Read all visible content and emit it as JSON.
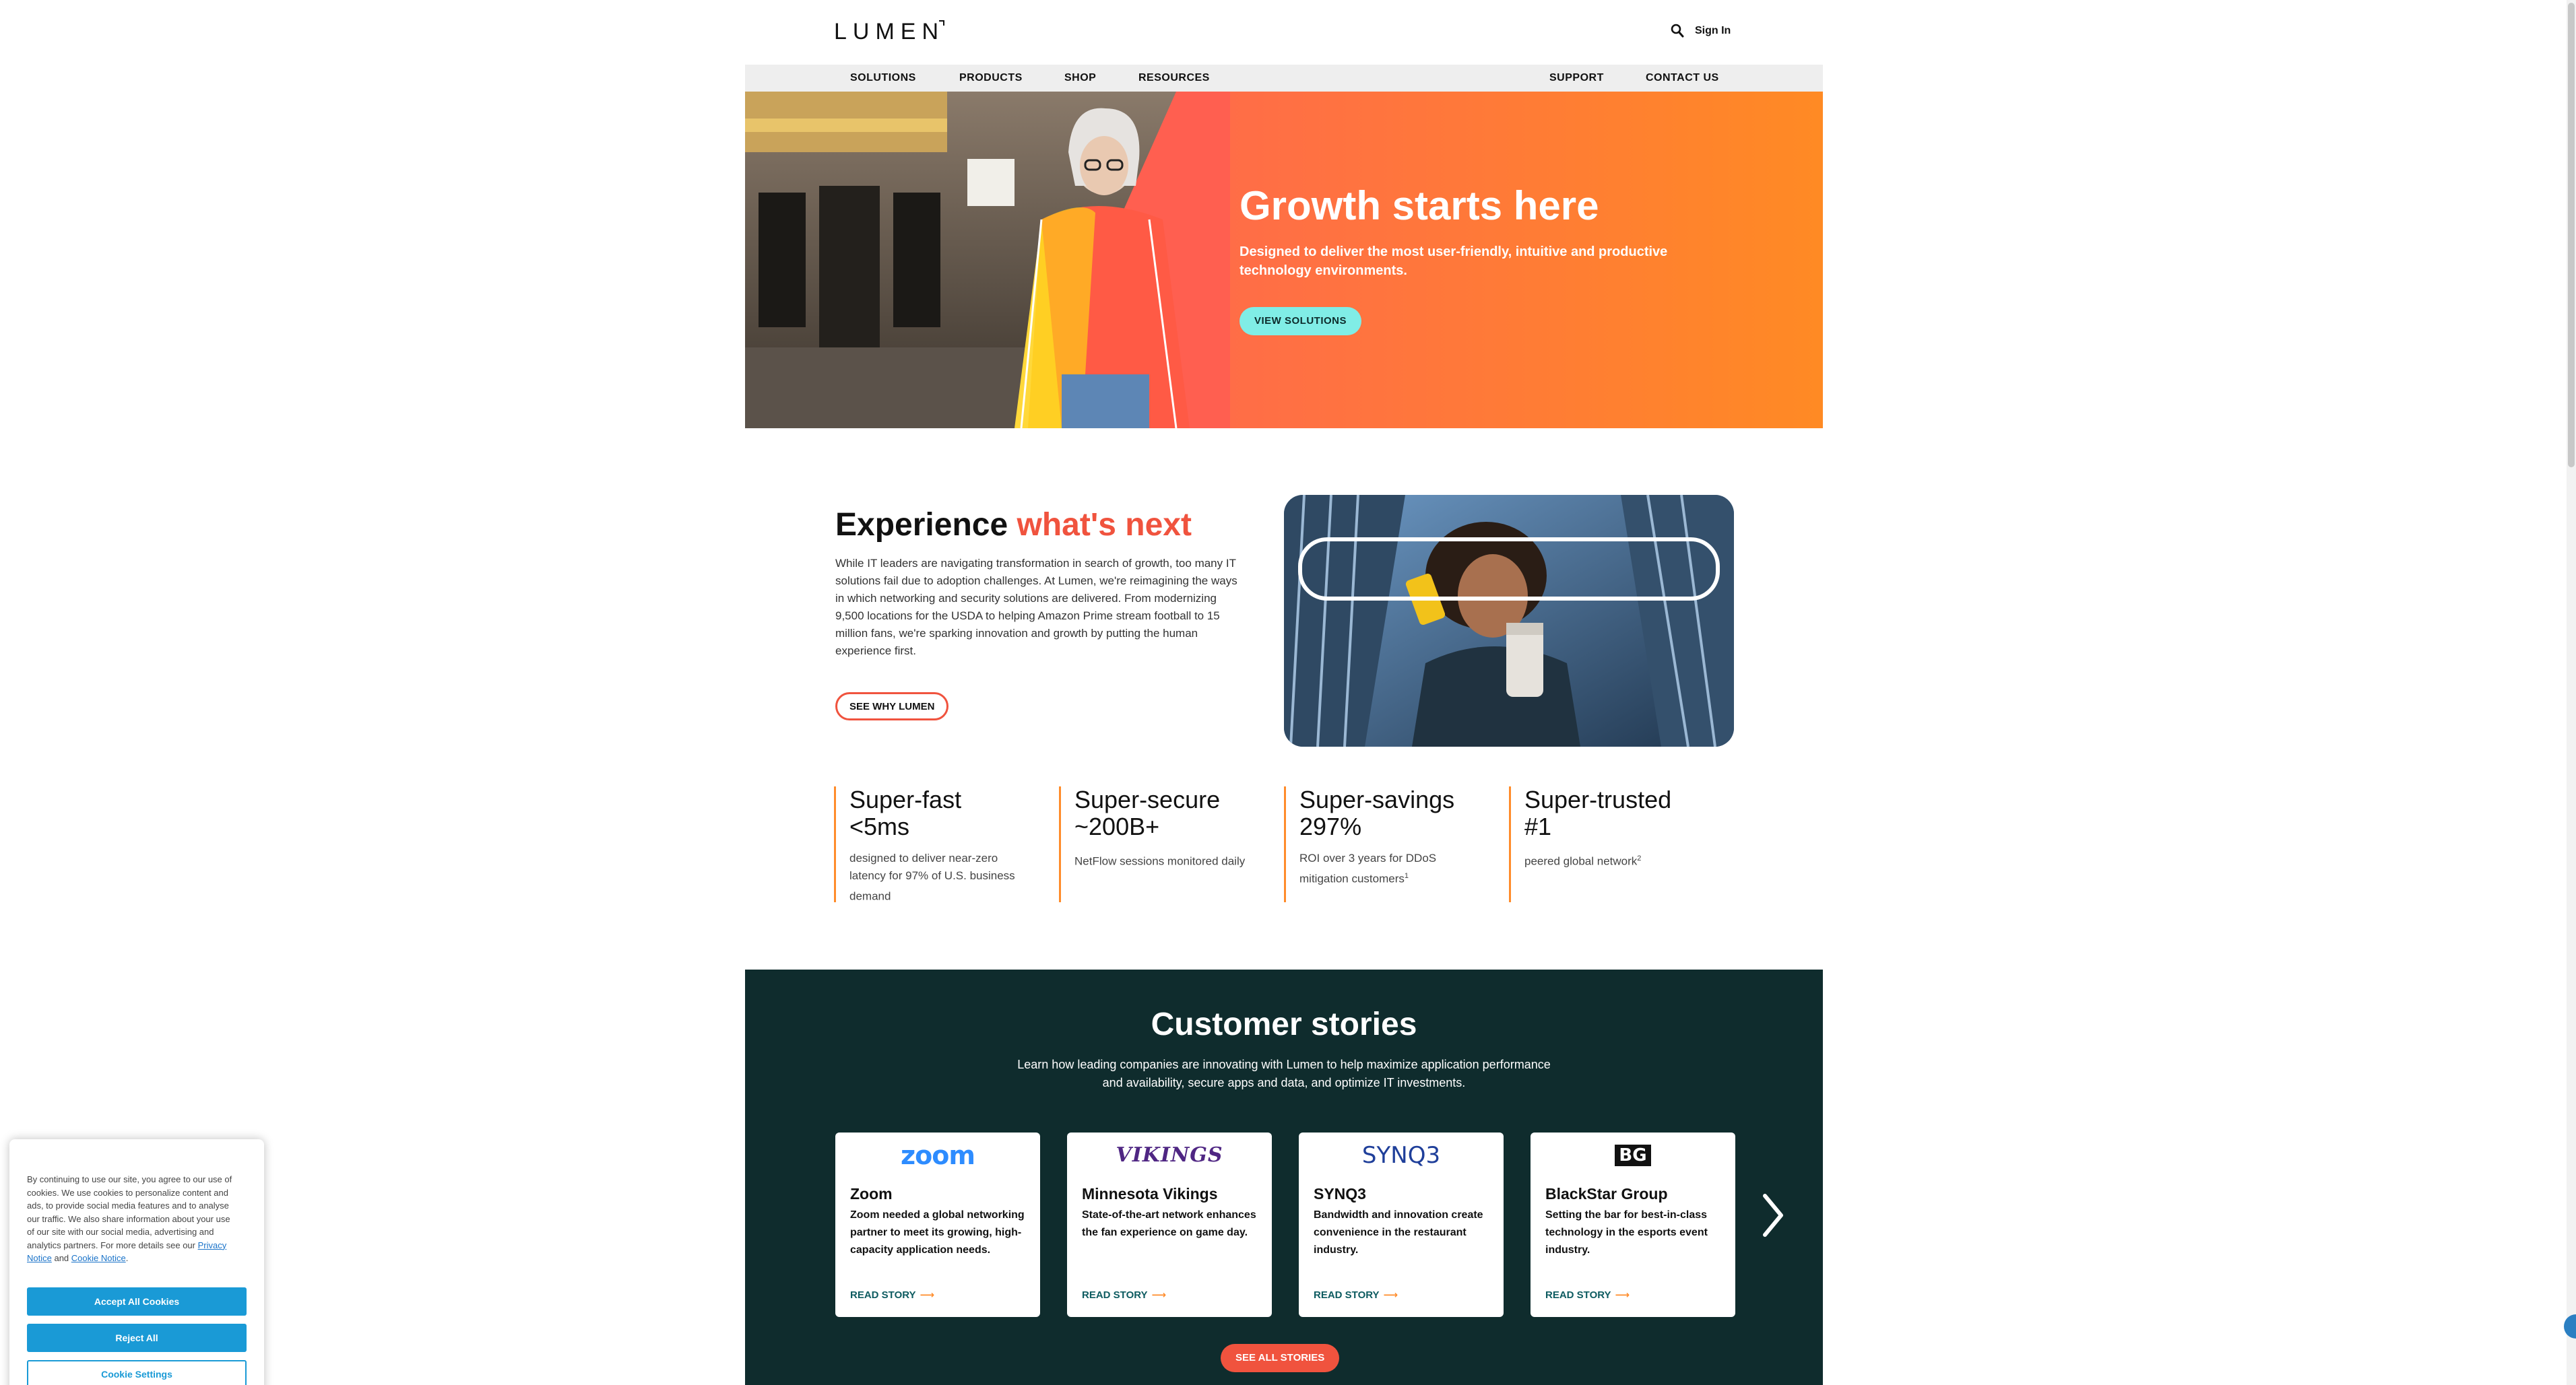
{
  "header": {
    "logo": "LUMEN",
    "signin": "Sign In"
  },
  "nav": {
    "items": [
      "SOLUTIONS",
      "PRODUCTS",
      "SHOP",
      "RESOURCES"
    ],
    "right_items": [
      "SUPPORT",
      "CONTACT US"
    ]
  },
  "hero": {
    "title": "Growth starts here",
    "subtitle": "Designed to deliver the most user-friendly, intuitive and productive technology environments.",
    "button": "VIEW SOLUTIONS"
  },
  "experience": {
    "title_a": "Experience ",
    "title_b": "what's next",
    "body": "While IT leaders are navigating transformation in search of growth, too many IT solutions fail due to adoption challenges. At Lumen, we're reimagining the ways in which networking and security solutions are delivered. From modernizing 9,500 locations for the USDA to helping Amazon Prime stream football to 15 million fans, we're sparking innovation and growth by putting the human experience first.",
    "button": "SEE WHY LUMEN"
  },
  "stats": [
    {
      "line1": "Super-fast",
      "line2": "<5ms",
      "desc": "designed to deliver near-zero latency for 97% of U.S. business demand",
      "sup": ""
    },
    {
      "line1": "Super-secure",
      "line2": "~200B+",
      "desc": "NetFlow sessions monitored daily",
      "sup": ""
    },
    {
      "line1": "Super-savings",
      "line2": "297%",
      "desc": "ROI over 3 years for DDoS mitigation customers",
      "sup": "1"
    },
    {
      "line1": "Super-trusted",
      "line2": "#1",
      "desc": "peered global network",
      "sup": "2"
    }
  ],
  "stories": {
    "title": "Customer stories",
    "subtitle": "Learn how leading companies are innovating with Lumen to help maximize application performance and availability, secure apps and data, and optimize IT investments.",
    "cards": [
      {
        "logo": "zoom",
        "name": "Zoom",
        "desc": "Zoom needed a global networking partner to meet its growing, high-capacity application needs.",
        "link": "READ STORY"
      },
      {
        "logo": "VIKINGS",
        "name": "Minnesota Vikings",
        "desc": "State-of-the-art network enhances the fan experience on game day.",
        "link": "READ STORY"
      },
      {
        "logo": "SYNQ3",
        "name": "SYNQ3",
        "desc": "Bandwidth and innovation create convenience in the restaurant industry.",
        "link": "READ STORY"
      },
      {
        "logo": "BG",
        "name": "BlackStar Group",
        "desc": "Setting the bar for best-in-class technology in the esports event industry.",
        "link": "READ STORY"
      }
    ],
    "button": "SEE ALL STORIES"
  },
  "cookie": {
    "text_main": "By continuing to use our site, you agree to our use of cookies. We use cookies to personalize content and ads, to provide social media features and to analyse our traffic. We also share information about your use of our site with our social media, advertising and analytics partners. For more details see our ",
    "privacy_link": "Privacy Notice",
    "text_and": " and ",
    "cookie_link": "Cookie Notice",
    "text_end": ".",
    "accept": "Accept All Cookies",
    "reject": "Reject All",
    "settings": "Cookie Settings"
  },
  "colors": {
    "accent": "#f0533e",
    "orange": "#ff8c2b",
    "teal_dark": "#0f2c2d",
    "aqua": "#80ede6",
    "cookie_blue": "#1a9ad6"
  },
  "icons": [
    "search-icon",
    "arrow-right-icon",
    "chevron-right-icon"
  ]
}
